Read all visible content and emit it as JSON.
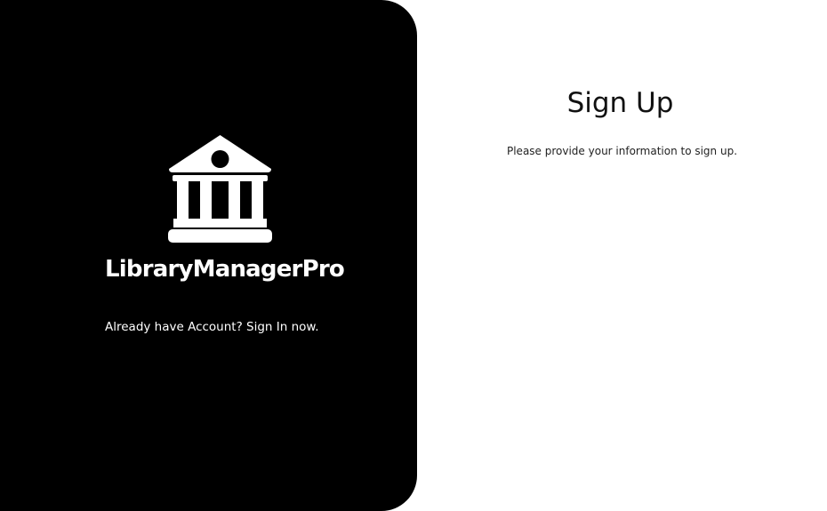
{
  "brand": {
    "name": "LibraryManagerPro",
    "logo_icon": "library-building-icon"
  },
  "left_panel": {
    "signin_text": "Already have Account? Sign In now."
  },
  "form": {
    "title": "Sign Up",
    "subtitle": "Please provide your information to sign up."
  },
  "colors": {
    "panel_background": "#000000",
    "panel_text": "#ffffff",
    "page_background": "#ffffff",
    "heading_text": "#111111"
  }
}
